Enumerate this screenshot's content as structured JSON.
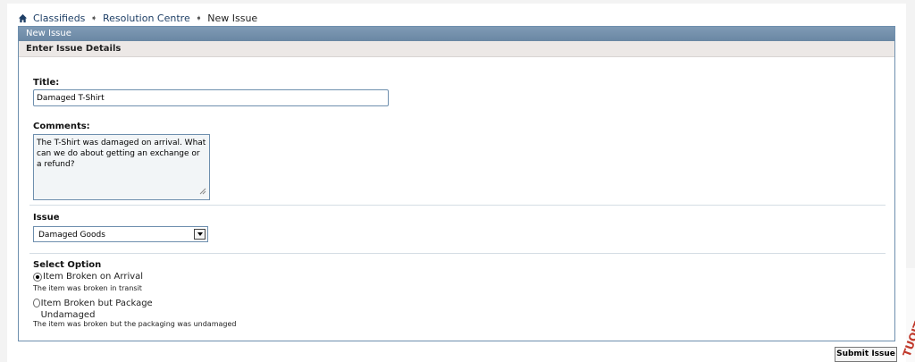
{
  "breadcrumb": {
    "items": [
      "Classifieds",
      "Resolution Centre"
    ],
    "current": "New Issue"
  },
  "panel": {
    "title": "New Issue",
    "section": "Enter Issue Details"
  },
  "form": {
    "title_label": "Title:",
    "title_value": "Damaged T-Shirt",
    "comments_label": "Comments:",
    "comments_value": "The T-Shirt was damaged on arrival. What can we do about getting an exchange or a refund?",
    "issue_label": "Issue",
    "issue_selected": "Damaged Goods",
    "option_label": "Select Option",
    "options": [
      {
        "label": "Item Broken on Arrival",
        "help": "The item was broken in transit",
        "selected": true
      },
      {
        "label": "Item Broken but Package Undamaged",
        "help": "The item was broken but the packaging was undamaged",
        "selected": false
      }
    ]
  },
  "submit_label": "Submit Issue",
  "watermark": "TUOITREIT.VN",
  "colors": {
    "panel_header": "#7690ab",
    "link": "#1e3f66",
    "border": "#6e8fae",
    "watermark": "#c0392b"
  }
}
